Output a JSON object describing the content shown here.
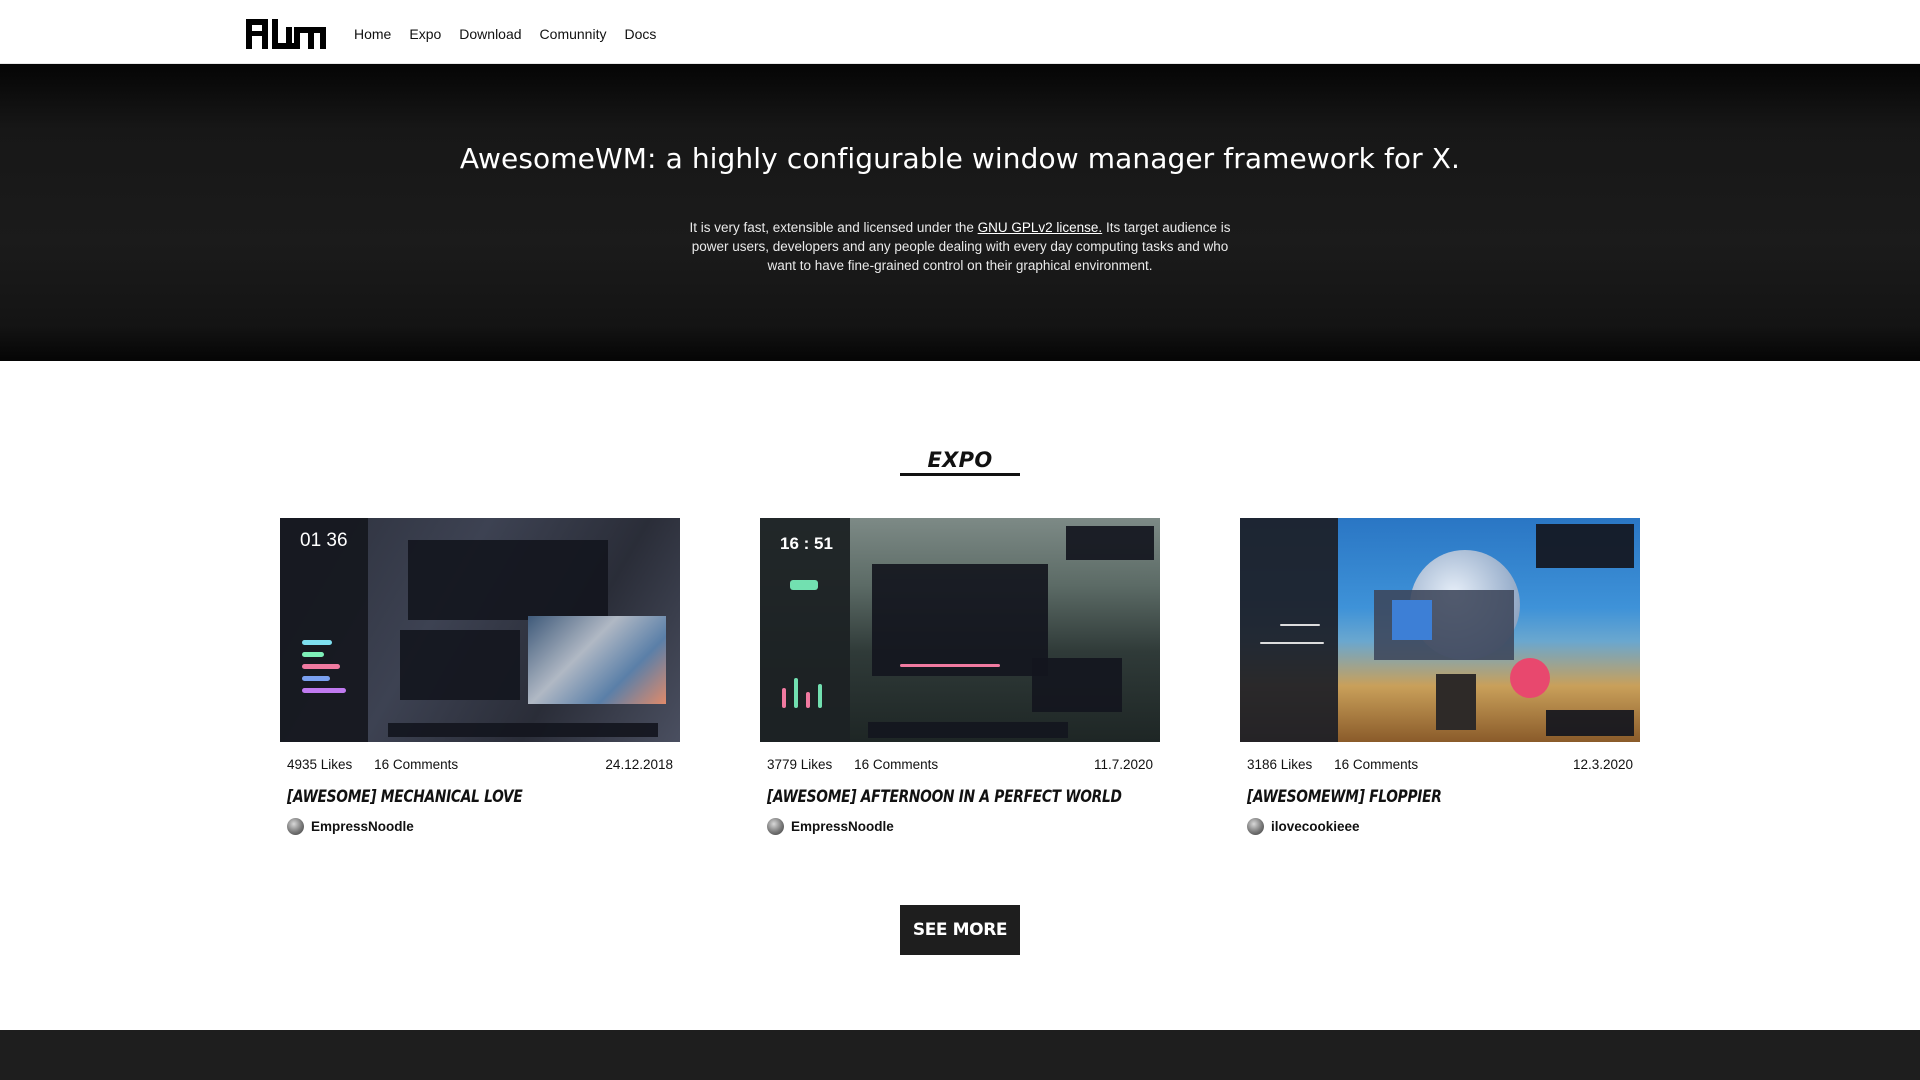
{
  "nav": {
    "logo_text": "AWM",
    "links": [
      "Home",
      "Expo",
      "Download",
      "Comunnity",
      "Docs"
    ]
  },
  "hero": {
    "title": "AwesomeWM: a highly configurable window manager framework for X.",
    "desc_before": "It is very fast, extensible and licensed under the ",
    "desc_link": "GNU GPLv2 license.",
    "desc_after": " Its target audience is power users, developers and any people dealing with every day computing tasks and who want to have fine-grained control on their graphical environment."
  },
  "expo": {
    "title": "EXPO",
    "cards": [
      {
        "likes": "4935 Likes",
        "comments": "16 Comments",
        "date": "24.12.2018",
        "title": "[AWESOME] MECHANICAL LOVE",
        "author": "EmpressNoodle",
        "thumb_clock": "01 36"
      },
      {
        "likes": "3779 Likes",
        "comments": "16 Comments",
        "date": "11.7.2020",
        "title": "[AWESOME] AFTERNOON IN A PERFECT WORLD",
        "author": "EmpressNoodle",
        "thumb_clock": "16 : 51"
      },
      {
        "likes": "3186 Likes",
        "comments": "16 Comments",
        "date": "12.3.2020",
        "title": "[AWESOMEWM] FLOPPIER",
        "author": "ilovecookieee",
        "thumb_clock": ""
      }
    ],
    "see_more": "SEE MORE"
  },
  "colors": {
    "hero_bg": "#1b1b1b",
    "button_bg": "#1e1e1e",
    "footer_bg": "#1e1e1e"
  }
}
